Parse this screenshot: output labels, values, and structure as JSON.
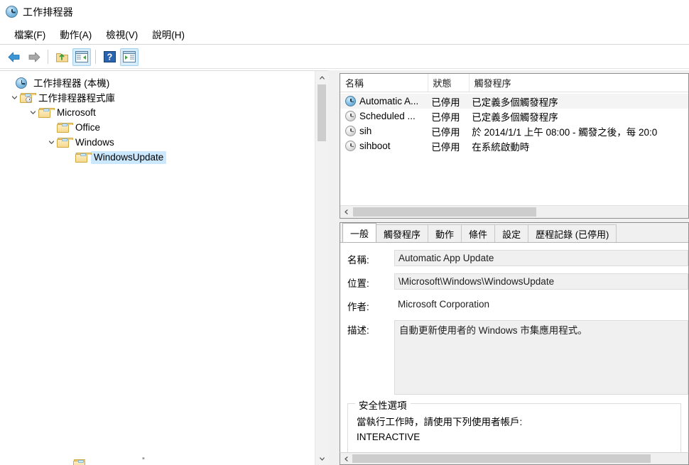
{
  "window": {
    "title": "工作排程器",
    "icon": "clock-icon"
  },
  "menubar": {
    "items": [
      {
        "label": "檔案(F)",
        "name": "menu-file"
      },
      {
        "label": "動作(A)",
        "name": "menu-action"
      },
      {
        "label": "檢視(V)",
        "name": "menu-view"
      },
      {
        "label": "說明(H)",
        "name": "menu-help"
      }
    ]
  },
  "toolbar": {
    "buttons": [
      {
        "name": "back-button",
        "icon": "back-arrow-icon",
        "active": false
      },
      {
        "name": "forward-button",
        "icon": "forward-arrow-icon",
        "active": false
      },
      {
        "name": "up-one-level-button",
        "icon": "folder-up-icon",
        "active": false
      },
      {
        "name": "show-hide-console-tree-button",
        "icon": "console-tree-icon",
        "active": true
      },
      {
        "name": "help-button",
        "icon": "question-mark-icon",
        "active": false
      },
      {
        "name": "show-hide-action-pane-button",
        "icon": "action-pane-icon",
        "active": true
      }
    ]
  },
  "tree": {
    "nodes": [
      {
        "label": "工作排程器 (本機)",
        "indent": 0,
        "icon": "clock-icon",
        "expander": "none",
        "selected": false
      },
      {
        "label": "工作排程器程式庫",
        "indent": 1,
        "icon": "folder-clock-icon",
        "expander": "expanded",
        "selected": false
      },
      {
        "label": "Microsoft",
        "indent": 2,
        "icon": "folder-icon",
        "expander": "expanded",
        "selected": false
      },
      {
        "label": "Office",
        "indent": 3,
        "icon": "folder-icon",
        "expander": "none",
        "selected": false
      },
      {
        "label": "Windows",
        "indent": 3,
        "icon": "folder-icon",
        "expander": "expanded",
        "selected": false
      },
      {
        "label": "WindowsUpdate",
        "indent": 4,
        "icon": "folder-icon",
        "expander": "none",
        "selected": true
      }
    ]
  },
  "task_list": {
    "columns": [
      {
        "label": "名稱",
        "name": "column-name"
      },
      {
        "label": "狀態",
        "name": "column-status"
      },
      {
        "label": "觸發程序",
        "name": "column-triggers"
      }
    ],
    "rows": [
      {
        "name": "Automatic A...",
        "status": "已停用",
        "triggers": "已定義多個觸發程序",
        "icon": "clock-icon-blue",
        "selected": true
      },
      {
        "name": "Scheduled ...",
        "status": "已停用",
        "triggers": "已定義多個觸發程序",
        "icon": "clock-icon-gray",
        "selected": false
      },
      {
        "name": "sih",
        "status": "已停用",
        "triggers": "於 2014/1/1 上午 08:00 - 觸發之後，每 20:0",
        "icon": "clock-icon-gray",
        "selected": false
      },
      {
        "name": "sihboot",
        "status": "已停用",
        "triggers": "在系統啟動時",
        "icon": "clock-icon-gray",
        "selected": false
      }
    ]
  },
  "detail": {
    "tabs": [
      {
        "label": "一般",
        "name": "tab-general",
        "active": true
      },
      {
        "label": "觸發程序",
        "name": "tab-triggers",
        "active": false
      },
      {
        "label": "動作",
        "name": "tab-actions",
        "active": false
      },
      {
        "label": "條件",
        "name": "tab-conditions",
        "active": false
      },
      {
        "label": "設定",
        "name": "tab-settings",
        "active": false
      },
      {
        "label": "歷程記錄 (已停用)",
        "name": "tab-history",
        "active": false
      }
    ],
    "fields": {
      "name_label": "名稱:",
      "name_value": "Automatic App Update",
      "location_label": "位置:",
      "location_value": "\\Microsoft\\Windows\\WindowsUpdate",
      "author_label": "作者:",
      "author_value": "Microsoft Corporation",
      "description_label": "描述:",
      "description_value": "自動更新使用者的 Windows 市集應用程式。"
    },
    "security_group": {
      "title": "安全性選項",
      "run_as_label": "當執行工作時，請使用下列使用者帳戶:",
      "account_value": "INTERACTIVE"
    }
  },
  "colors": {
    "selection_blue": "#cce8ff",
    "row_selected_gray": "#f4f4f4",
    "panel_border": "#8e8e8e",
    "chrome_bg": "#f0f0f0",
    "scroll_thumb": "#cdcdcd",
    "toolbar_active": "#d7ecfb"
  }
}
